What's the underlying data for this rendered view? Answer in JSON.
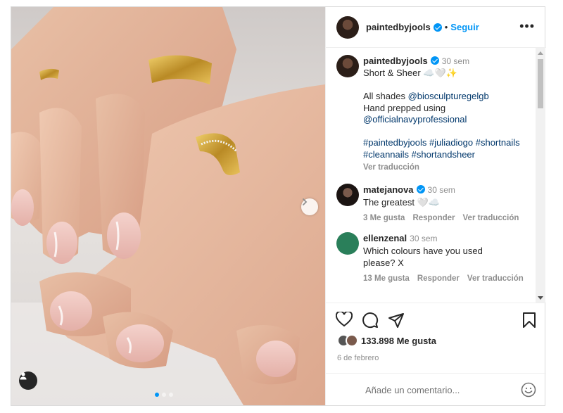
{
  "header": {
    "username": "paintedbyjools",
    "separator": "•",
    "follow_label": "Seguir",
    "more_label": "•••"
  },
  "caption": {
    "username": "paintedbyjools",
    "time": "30 sem",
    "lines": [
      "Short & Sheer ☁️🤍✨",
      "",
      "All shades",
      "@biosculpturegelgb",
      "Hand prepped using",
      "@officialnavyprofessional",
      "",
      "#paintedbyjools #juliadiogo #shortnails",
      "#cleannails #shortandsheer"
    ],
    "translate_label": "Ver traducción"
  },
  "comments": [
    {
      "username": "matejanova",
      "verified": true,
      "time": "30 sem",
      "text": "The greatest 🤍☁️",
      "likes": "3 Me gusta",
      "reply": "Responder",
      "translate": "Ver traducción"
    },
    {
      "username": "ellenzenal",
      "verified": false,
      "time": "30 sem",
      "text": "Which colours have you used please? X",
      "likes": "13 Me gusta",
      "reply": "Responder",
      "translate": "Ver traducción"
    }
  ],
  "actions": {
    "likes_count": "133.898 Me gusta",
    "date": "6 de febrero"
  },
  "comment_box": {
    "placeholder": "Añade un comentario..."
  },
  "carousel": {
    "total": 3,
    "current": 1
  },
  "colors": {
    "accent": "#0095f6",
    "link": "#00376b",
    "muted": "#8e8e8e",
    "text": "#262626"
  }
}
